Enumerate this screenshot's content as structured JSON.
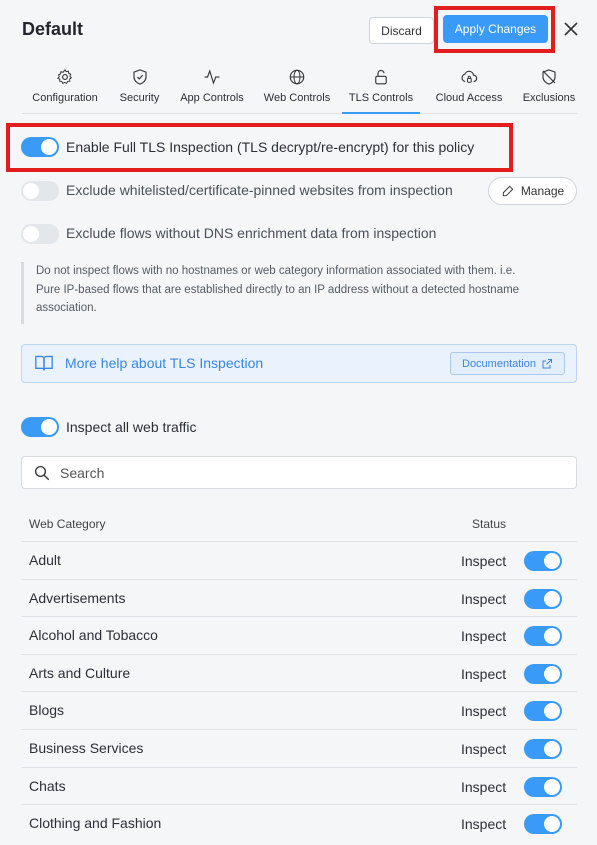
{
  "header": {
    "title": "Default",
    "discard_label": "Discard",
    "apply_label": "Apply Changes"
  },
  "tabs": [
    {
      "label": "Configuration",
      "icon": "gear-icon"
    },
    {
      "label": "Security",
      "icon": "shield-check-icon"
    },
    {
      "label": "App Controls",
      "icon": "activity-icon"
    },
    {
      "label": "Web Controls",
      "icon": "globe-icon"
    },
    {
      "label": "TLS Controls",
      "icon": "lock-icon",
      "active": true
    },
    {
      "label": "Cloud Access",
      "icon": "cloud-lock-icon"
    },
    {
      "label": "Exclusions",
      "icon": "shield-off-icon"
    }
  ],
  "options": {
    "full_tls": {
      "label": "Enable Full TLS Inspection (TLS decrypt/re-encrypt) for this policy",
      "enabled": true
    },
    "exclude_whitelisted": {
      "label": "Exclude whitelisted/certificate-pinned websites from inspection",
      "enabled": false
    },
    "manage_label": "Manage",
    "exclude_no_dns": {
      "label": "Exclude flows without DNS enrichment data from inspection",
      "enabled": false
    },
    "info_note": "Do not inspect flows with no hostnames or web category information associated with them. i.e. Pure IP-based flows that are established directly to an IP address without a detected hostname association."
  },
  "help": {
    "text": "More help about TLS Inspection",
    "doc_label": "Documentation"
  },
  "inspect_all": {
    "label": "Inspect all web traffic",
    "enabled": true
  },
  "search": {
    "placeholder": "Search"
  },
  "table": {
    "headers": {
      "category": "Web Category",
      "status": "Status"
    },
    "rows": [
      {
        "category": "Adult",
        "status": "Inspect",
        "enabled": true
      },
      {
        "category": "Advertisements",
        "status": "Inspect",
        "enabled": true
      },
      {
        "category": "Alcohol and Tobacco",
        "status": "Inspect",
        "enabled": true
      },
      {
        "category": "Arts and Culture",
        "status": "Inspect",
        "enabled": true
      },
      {
        "category": "Blogs",
        "status": "Inspect",
        "enabled": true
      },
      {
        "category": "Business Services",
        "status": "Inspect",
        "enabled": true
      },
      {
        "category": "Chats",
        "status": "Inspect",
        "enabled": true
      },
      {
        "category": "Clothing and Fashion",
        "status": "Inspect",
        "enabled": true
      }
    ]
  },
  "colors": {
    "accent": "#3a9af7",
    "highlight": "#e11d1d"
  }
}
